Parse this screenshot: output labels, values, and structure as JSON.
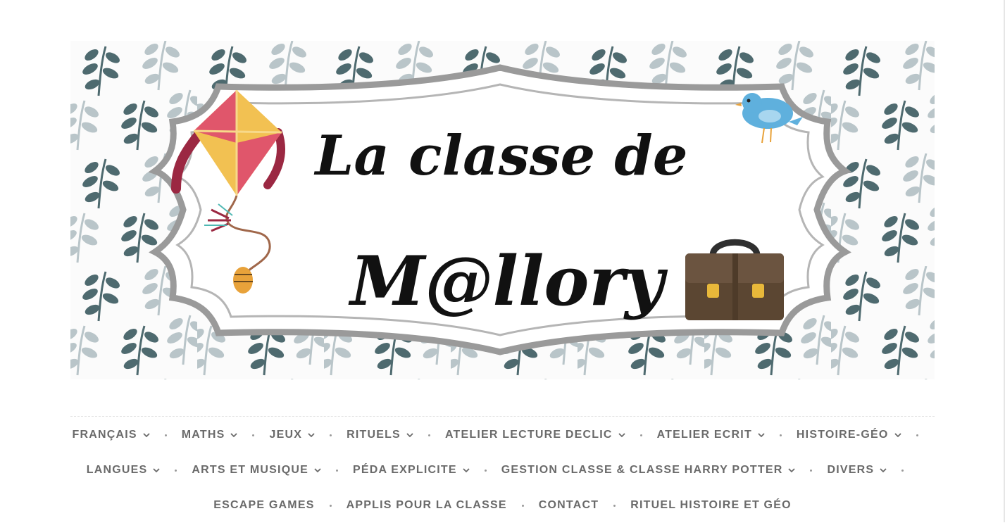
{
  "banner": {
    "title_line1": "La classe de",
    "title_line2": "M@llory",
    "colors": {
      "leaf_dark": "#4e6a6f",
      "leaf_light": "#b9c5c9",
      "frame": "#9a9a9a",
      "kite_red": "#e0566b",
      "kite_yellow": "#f2c152",
      "kite_tail": "#9b2842",
      "bird": "#5fb0dd",
      "briefcase": "#5b4632",
      "briefcase_clasp": "#e8b83a"
    }
  },
  "nav": {
    "rows": [
      [
        {
          "label": "FRANÇAIS",
          "dropdown": true
        },
        {
          "label": "MATHS",
          "dropdown": true
        },
        {
          "label": "JEUX",
          "dropdown": true
        },
        {
          "label": "RITUELS",
          "dropdown": true
        },
        {
          "label": "ATELIER LECTURE DECLIC",
          "dropdown": true
        },
        {
          "label": "ATELIER ECRIT",
          "dropdown": true
        },
        {
          "label": "HISTOIRE-GÉO",
          "dropdown": true
        }
      ],
      [
        {
          "label": "LANGUES",
          "dropdown": true
        },
        {
          "label": "ARTS ET MUSIQUE",
          "dropdown": true
        },
        {
          "label": "PÉDA EXPLICITE",
          "dropdown": true
        },
        {
          "label": "GESTION CLASSE & CLASSE HARRY POTTER",
          "dropdown": true
        },
        {
          "label": "DIVERS",
          "dropdown": true
        }
      ],
      [
        {
          "label": "ESCAPE GAMES",
          "dropdown": false
        },
        {
          "label": "APPLIS POUR LA CLASSE",
          "dropdown": false
        },
        {
          "label": "CONTACT",
          "dropdown": false
        },
        {
          "label": "RITUEL HISTOIRE ET GÉO",
          "dropdown": false
        }
      ]
    ],
    "text_color": "#6a6a6a",
    "separator_icon": "dot-icon",
    "dropdown_icon": "chevron-down-icon"
  }
}
